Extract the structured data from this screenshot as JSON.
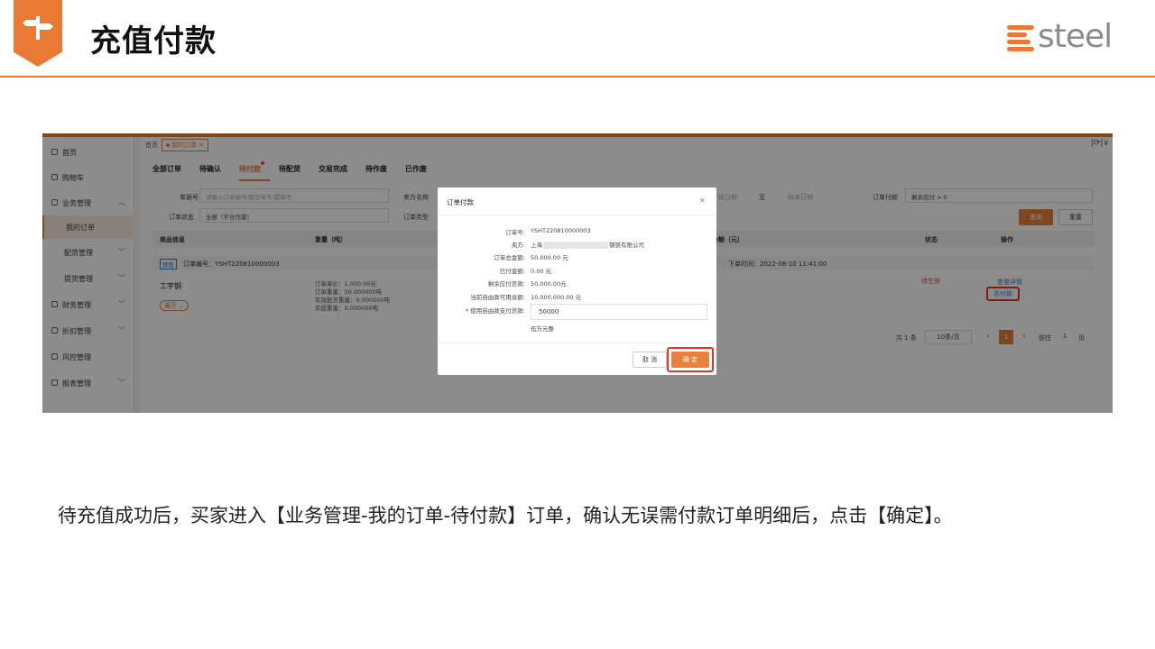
{
  "slide": {
    "title": "充值付款",
    "logo_text": "steel",
    "caption": "待充值成功后，买家进入【业务管理-我的订单-待付款】订单，确认无误需付款订单明细后，点击【确定】。",
    "accent_color": "#e87a35"
  },
  "app": {
    "sidebar": [
      {
        "label": "首页",
        "icon": "home-icon"
      },
      {
        "label": "购物车",
        "icon": "cart-icon"
      },
      {
        "label": "业务管理",
        "icon": "business-icon",
        "chevron": "^"
      },
      {
        "label": "我的订单",
        "sub": true,
        "active": true
      },
      {
        "label": "配货管理",
        "sub": true,
        "chevron": "v"
      },
      {
        "label": "提货管理",
        "sub": true,
        "chevron": "v"
      },
      {
        "label": "财务管理",
        "icon": "finance-icon",
        "chevron": "v"
      },
      {
        "label": "折扣管理",
        "icon": "discount-icon",
        "chevron": "v"
      },
      {
        "label": "风控管理",
        "icon": "risk-icon"
      },
      {
        "label": "报表管理",
        "icon": "report-icon",
        "chevron": "v"
      }
    ],
    "breadcrumb": {
      "home": "首页",
      "current": "我的订单"
    },
    "tabs": [
      "全部订单",
      "待确认",
      "待付款",
      "待配货",
      "交易完成",
      "待作废",
      "已作废"
    ],
    "filters": {
      "doc_no_label": "单据号",
      "doc_no_placeholder": "请输入订单编号/配货单号/提单号",
      "seller_label": "卖方名称",
      "end_date_placeholder": "结束日期",
      "start_date_placeholder": "开始日期",
      "to": "至",
      "order_pay_label": "订单付款",
      "order_pay_value": "剩余应付 > 0",
      "status_label": "订单状态",
      "status_value": "全部（不含作废）",
      "type_label": "订单类型",
      "query_button": "查询",
      "reset_button": "重置"
    },
    "table": {
      "headers": [
        "商品信息",
        "重量（吨）",
        "金额（元）",
        "状态",
        "操作"
      ],
      "prefix_tag": "预售",
      "order_no": "订单编号：YSHT220810000003",
      "order_time": "下单时间：2022-08-10 11:41:00",
      "product": "工字钢",
      "expand": "展开",
      "details": [
        "订单单价：1,000.00元",
        "订单重量：50.000000吨",
        "有效配货重量：0.000000吨",
        "实提重量：0.000000吨"
      ],
      "status": "待生效",
      "view_link": "查看详情",
      "pay_link": "去付款"
    },
    "pager": {
      "total": "共 1 条",
      "page_size": "10条/页",
      "prev": "‹",
      "current": "1",
      "next": "›",
      "goto": "前往",
      "goto_value": "1",
      "page": "页"
    }
  },
  "modal": {
    "title": "订单付款",
    "close": "×",
    "rows": [
      {
        "label": "订单号:",
        "value": "YSHT220810000003"
      },
      {
        "label": "卖方:",
        "value_prefix": "上海",
        "value_suffix": "钢铁有限公司"
      },
      {
        "label": "订单总金额:",
        "value": "50,000.00 元"
      },
      {
        "label": "已付金额:",
        "value": "0.00 元"
      },
      {
        "label": "剩余应付货款:",
        "value": "50,000.00元"
      },
      {
        "label": "当前自由款可用余额:",
        "value": "10,000,000.00 元"
      }
    ],
    "pay_label": "* 使用自由款支付货款:",
    "pay_value": "50000",
    "amount_in_words": "伍万元整",
    "cancel_button": "取 消",
    "confirm_button": "确 定"
  }
}
